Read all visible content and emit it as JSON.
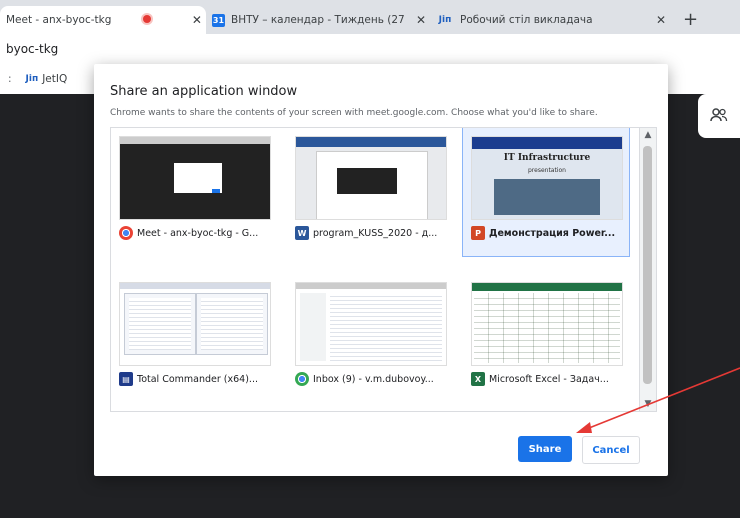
{
  "browser": {
    "tabs": [
      {
        "title": "Meet - anx-byoc-tkg"
      },
      {
        "title": "ВНТУ – календар - Тиждень (27"
      },
      {
        "title": "Робочий стіл викладача"
      }
    ],
    "new_tab_symbol": "+",
    "close_symbol": "✕",
    "address": "byoc-tkg",
    "bookmark": {
      "icon_text": "Jіп",
      "label": "JetIQ"
    }
  },
  "dialog": {
    "title": "Share an application window",
    "subtitle": "Chrome wants to share the contents of your screen with meet.google.com. Choose what you'd like to share.",
    "windows": [
      {
        "label": "Meet - anx-byoc-tkg - G...",
        "icon": "chrome-icon",
        "selected": false
      },
      {
        "label": "program_KUSS_2020 - д...",
        "icon": "word-icon",
        "selected": false
      },
      {
        "label": "Демонстрация Power...",
        "icon": "powerpoint-icon",
        "selected": true,
        "slide_title": "IT Infrastructure",
        "slide_subtitle": "presentation"
      },
      {
        "label": "Total Commander (x64)...",
        "icon": "total-commander-icon",
        "selected": false
      },
      {
        "label": "Inbox (9) - v.m.dubovoy...",
        "icon": "chrome-icon",
        "selected": false
      },
      {
        "label": "Microsoft Excel - Задач...",
        "icon": "excel-icon",
        "selected": false
      }
    ],
    "share_label": "Share",
    "cancel_label": "Cancel"
  },
  "colors": {
    "accent": "#1a73e8",
    "annotation_arrow": "#e53935"
  }
}
